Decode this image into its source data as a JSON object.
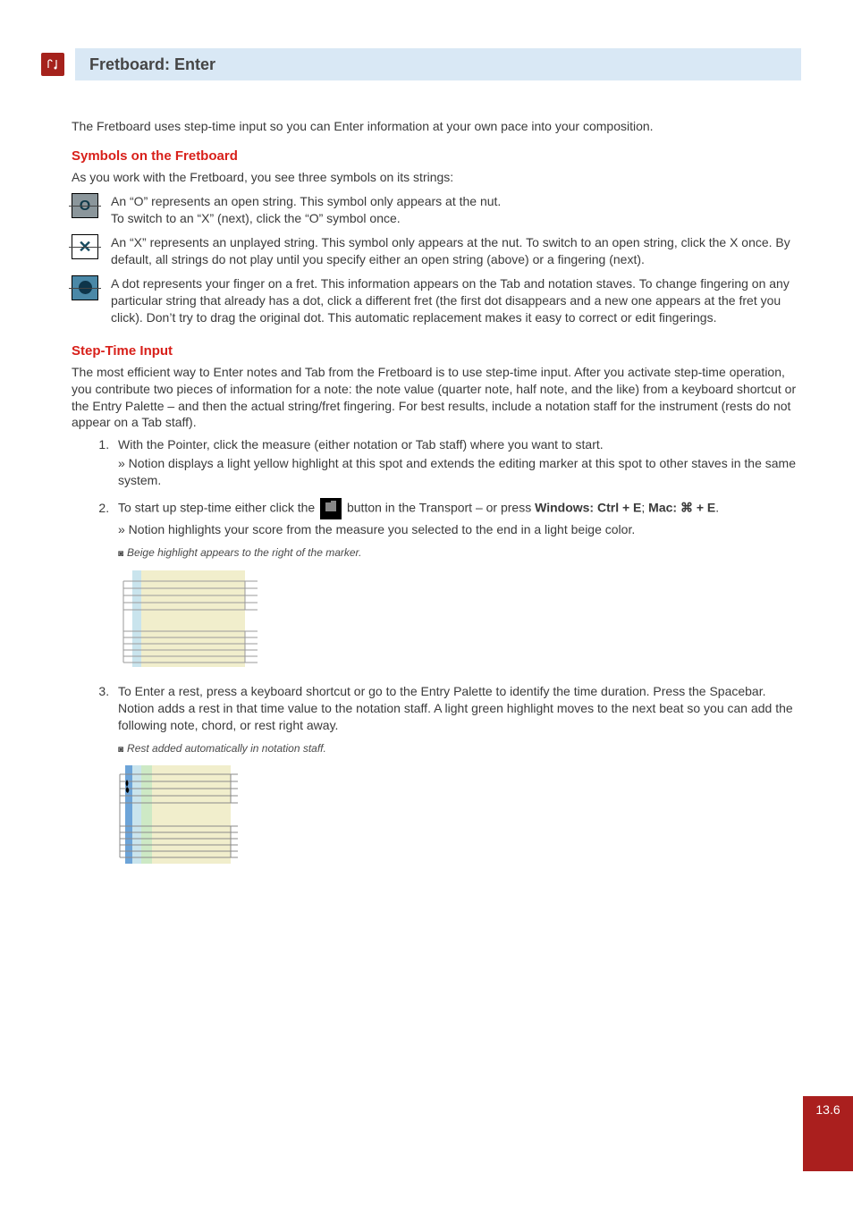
{
  "title": "Fretboard: Enter",
  "intro": "The Fretboard uses step-time input so you can Enter information at your own pace into your composition.",
  "sec1": {
    "heading": "Symbols on the Fretboard",
    "lead": "As you work with the Fretboard, you see three symbols on its strings:",
    "o_line1": "An “O” represents an open string. This symbol only appears at the nut.",
    "o_line2": "To switch to an “X” (next), click the “O” symbol once.",
    "x_text": "An “X” represents an unplayed string. This symbol only appears at the nut. To switch to an open string, click the X once. By default, all strings do not play until you specify either an open string (above) or a fingering (next).",
    "dot_text": "A dot represents your finger on a fret. This information appears on the Tab and notation staves. To change fingering on any particular string that already has a dot, click a different fret (the first dot disappears and a new one appears at the fret you click). Don’t try to drag the original dot. This automatic replacement makes it easy to correct or edit fingerings."
  },
  "sec2": {
    "heading": "Step-Time Input",
    "para": "The most efficient way to Enter notes and Tab from the Fretboard is to use step-time input. After you activate step-time operation, you contribute two pieces of information for a note: the note value (quarter note, half note, and the like) from a keyboard shortcut or the Entry Palette – and then the actual string/fret fingering. For best results, include a notation staff for the instrument (rests do not appear on a Tab staff).",
    "step1_main": "With the Pointer, click the measure (either notation or Tab staff) where you want to start.",
    "step1_sub": "» Notion displays a light yellow highlight at this spot and extends the editing marker at this spot to other staves in the same system.",
    "step2_pre": "To start up step-time either click the ",
    "step2_post_a": " button in the Transport – or press ",
    "step2_win_label": "Windows:",
    "step2_win_key": " Ctrl + E",
    "step2_sep": "; ",
    "step2_mac_label": "Mac:",
    "step2_mac_key": " ⌘ + E",
    "step2_end": ".",
    "step2_sub": "» Notion highlights your score from the measure you selected to the end in a light beige color.",
    "caption1": "Beige highlight appears to the right of the marker.",
    "step3": "To Enter a rest, press a keyboard shortcut or go to the Entry Palette to identify the time duration. Press the Spacebar. Notion adds a rest in that time value to the notation staff. A light green highlight moves to the next beat so you can add the following note, chord, or rest right away.",
    "caption2": "Rest added automatically in notation staff."
  },
  "page_number": "13.6"
}
